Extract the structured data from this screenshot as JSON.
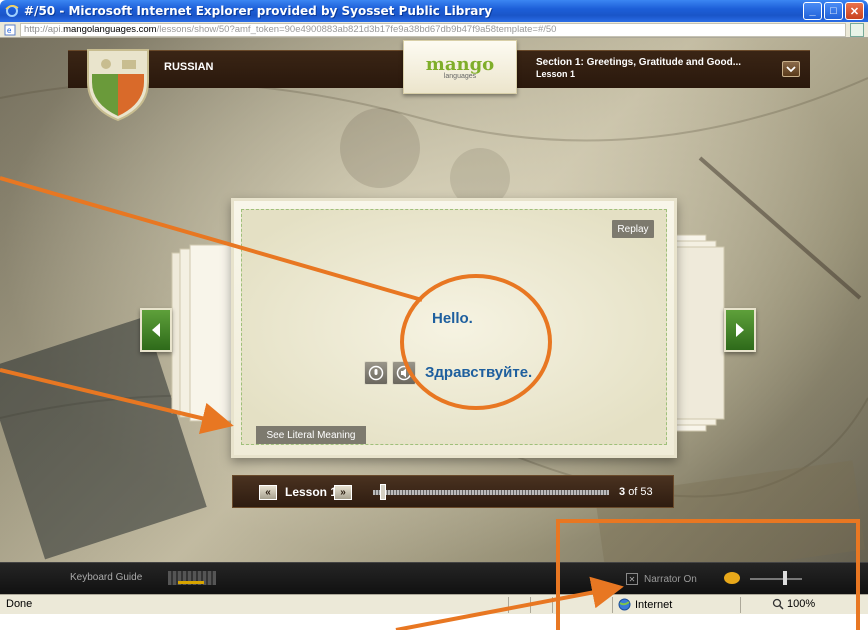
{
  "window": {
    "title": "#/50 - Microsoft Internet Explorer provided by Syosset Public Library"
  },
  "address": {
    "url_prefix": "http://api.",
    "url_domain": "mangolanguages.com",
    "url_rest": "/lessons/show/50?amf_token=90e4900883ab821d3b17fe9a38bd67db9b47f9a58template=#/50"
  },
  "header": {
    "language": "RUSSIAN",
    "brand": "mango",
    "brand_sub": "languages",
    "section_title": "Section 1: Greetings, Gratitude and Good...",
    "lesson_title": "Lesson 1"
  },
  "slide": {
    "replay_label": "Replay",
    "phrase_english": "Hello.",
    "phrase_target": "Здравствуйте.",
    "literal_label": "See Literal Meaning"
  },
  "progress": {
    "lesson_label": "Lesson 1",
    "current": "3",
    "of_label": "of 53",
    "position_fraction": 0.03
  },
  "bottom_toolbar": {
    "keyboard_guide": "Keyboard Guide",
    "narrator_label": "Narrator On"
  },
  "status": {
    "done": "Done",
    "zone": "Internet",
    "zoom": "100%"
  },
  "colors": {
    "annotation": "#e87722",
    "phrase_blue": "#1e5f9e",
    "mango_green": "#7fae2a",
    "xp_title_blue": "#1d5fd8"
  },
  "icons": [
    "ie-logo-icon",
    "minimize-icon",
    "maximize-icon",
    "close-icon",
    "page-icon",
    "compat-view-icon",
    "chevron-down-icon",
    "arrow-left-icon",
    "arrow-right-icon",
    "audio-icon",
    "speaker-icon",
    "rewind-icon",
    "fast-forward-icon",
    "narrator-toggle-icon",
    "speech-bubble-icon",
    "globe-icon",
    "zoom-icon"
  ]
}
